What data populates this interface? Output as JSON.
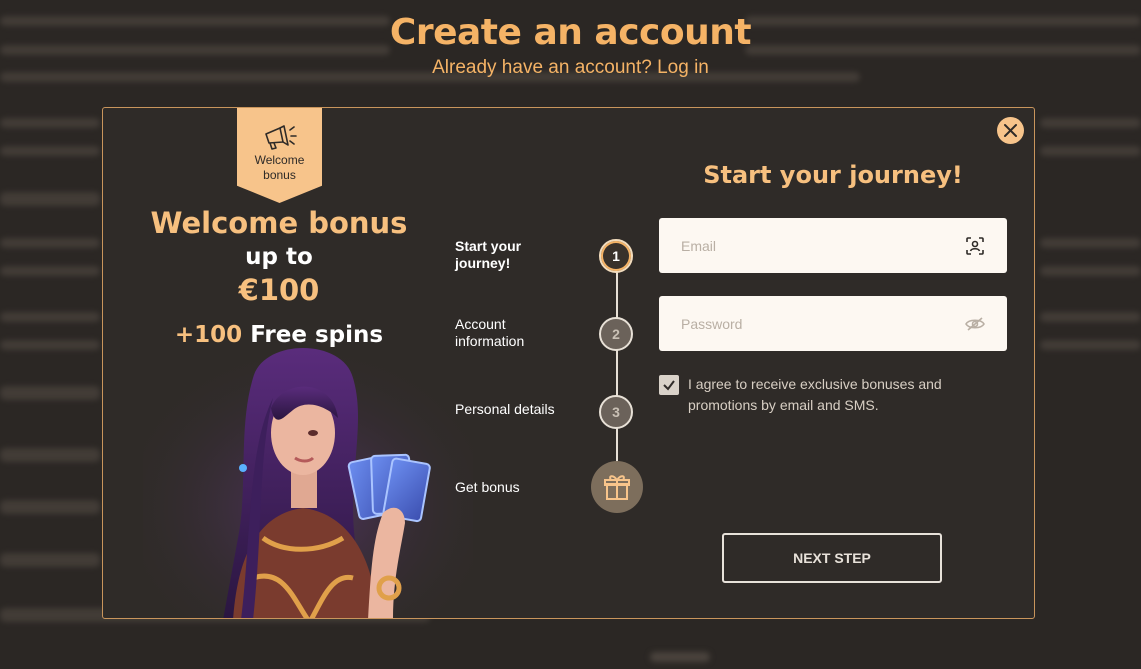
{
  "page": {
    "title": "Create an account",
    "subtitle": "Already have an account? Log in"
  },
  "modal": {
    "ribbon_label": "Welcome bonus",
    "bonus": {
      "title": "Welcome bonus",
      "up_to": "up to",
      "amount": "€100",
      "spins_count": "+100",
      "spins_label": " Free spins"
    },
    "steps": [
      {
        "label": "Start your journey!",
        "number": "1",
        "active": true
      },
      {
        "label": "Account information",
        "number": "2",
        "active": false
      },
      {
        "label": "Personal details",
        "number": "3",
        "active": false
      },
      {
        "label": "Get bonus",
        "icon": "gift-icon",
        "active": false
      }
    ],
    "form": {
      "heading": "Start your journey!",
      "email_placeholder": "Email",
      "password_placeholder": "Password",
      "agree_checked": true,
      "agree_text": "I agree to receive exclusive bonuses and promotions by email and SMS.",
      "next_label": "NEXT STEP"
    }
  },
  "colors": {
    "accent": "#f7c07f",
    "background": "#2b2724",
    "modal_background": "#2f2b28"
  }
}
